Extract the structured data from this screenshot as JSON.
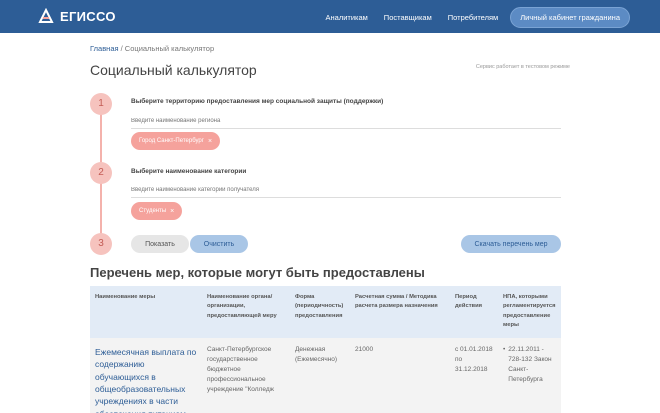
{
  "header": {
    "logo": "ЕГИССО",
    "nav": [
      "Аналитикам",
      "Поставщикам",
      "Потребителям"
    ],
    "cabinet": "Личный кабинет гражданина"
  },
  "breadcrumb": {
    "home": "Главная",
    "current": "/ Социальный калькулятор"
  },
  "page_title": "Социальный калькулятор",
  "service_note": "Сервис работает в тестовом режиме",
  "steps": [
    {
      "number": "1",
      "label": "Выберите территорию предоставления мер социальной защиты (поддержки)",
      "placeholder": "Введите наименование региона",
      "chip": "Город Санкт-Петербург"
    },
    {
      "number": "2",
      "label": "Выберите наименование категории",
      "placeholder": "Введите наименование категории получателя",
      "chip": "Студенты"
    },
    {
      "number": "3"
    }
  ],
  "buttons": {
    "show": "Показать",
    "clear": "Очистить",
    "download": "Скачать перечень мер"
  },
  "list_title": "Перечень мер, которые могут быть предоставлены",
  "table": {
    "headers": [
      "Наименование меры",
      "Наименование органа/организации, предоставляющей меру",
      "Форма (периодичность) предоставления",
      "Расчетная сумма / Методика расчета размера назначения",
      "Период действия",
      "НПА, которыми регламентируется предоставление меры"
    ],
    "rows": [
      {
        "measure": "Ежемесячная выплата по содержанию обучающихся в общеобразовательных учреждениях в части обеспечения питанием",
        "organization": "Санкт-Петербургское государственное бюджетное профессиональное учреждение \"Колледж",
        "form": "Денежная (Ежемесячно)",
        "amount": "21000",
        "period": "с 01.01.2018 по 31.12.2018",
        "npa": [
          "22.11.2011 - 728-132 Закон Санкт-Петербурга"
        ]
      }
    ]
  },
  "colors": {
    "header_bg": "#2d5d96",
    "accent_pink": "#f5a29c",
    "accent_blue": "#a9c6e6"
  }
}
